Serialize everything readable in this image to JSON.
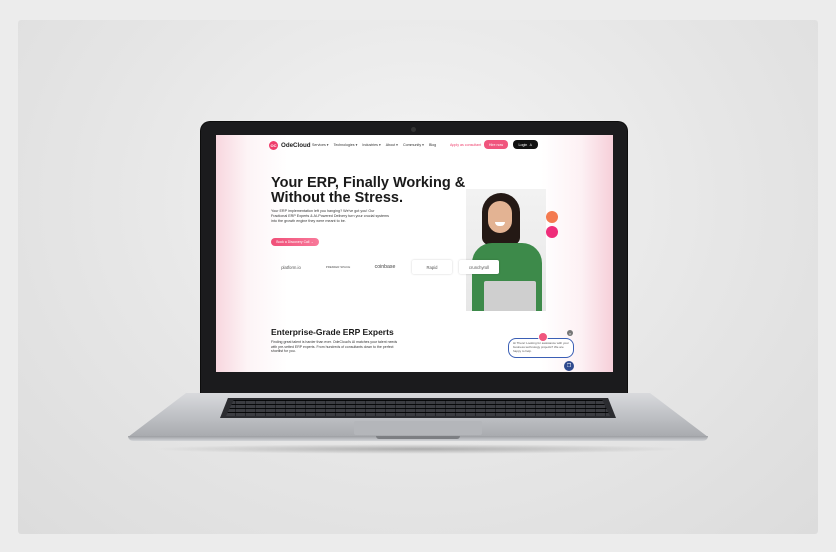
{
  "site": {
    "logo": "OdeCloud",
    "logo_mark": "OC",
    "nav": [
      "Services ▾",
      "Technologies ▾",
      "Industries ▾",
      "About ▾",
      "Community ▾",
      "Blog"
    ],
    "apply_link": "Apply as consultant",
    "hire_button": "Hire now",
    "login_button": "Login",
    "hero_title": "Your ERP, Finally Working & Without the Stress.",
    "hero_subtitle": "Your ERP implementation left you hanging? We've got you! Our Fractional ERP Experts & AI-Powered Delivery turn your crucial systems into the growth engine they were meant to be.",
    "cta": "Book a Discovery Call →",
    "client_logos": [
      "platform.io",
      "PREMIER SPACE",
      "coinbase",
      "Rapid",
      "crunchyroll"
    ],
    "section_title": "Enterprise-Grade ERP Experts",
    "section_text": "Finding great talent is harder than ever. OdeCloud's AI matches your talent needs with pre-vetted ERP experts. From hundreds of consultants down to the perfect shortlist for you.",
    "chat_message": "Hi There! Looking for assistance with your business technology projects? We are happy to help.",
    "chat_close": "×",
    "chat_icon": "chat-bubble-icon"
  },
  "colors": {
    "brand_pink": "#ef3d6b",
    "accent_orange": "#f47a4f",
    "chat_blue": "#2f4a8e"
  }
}
